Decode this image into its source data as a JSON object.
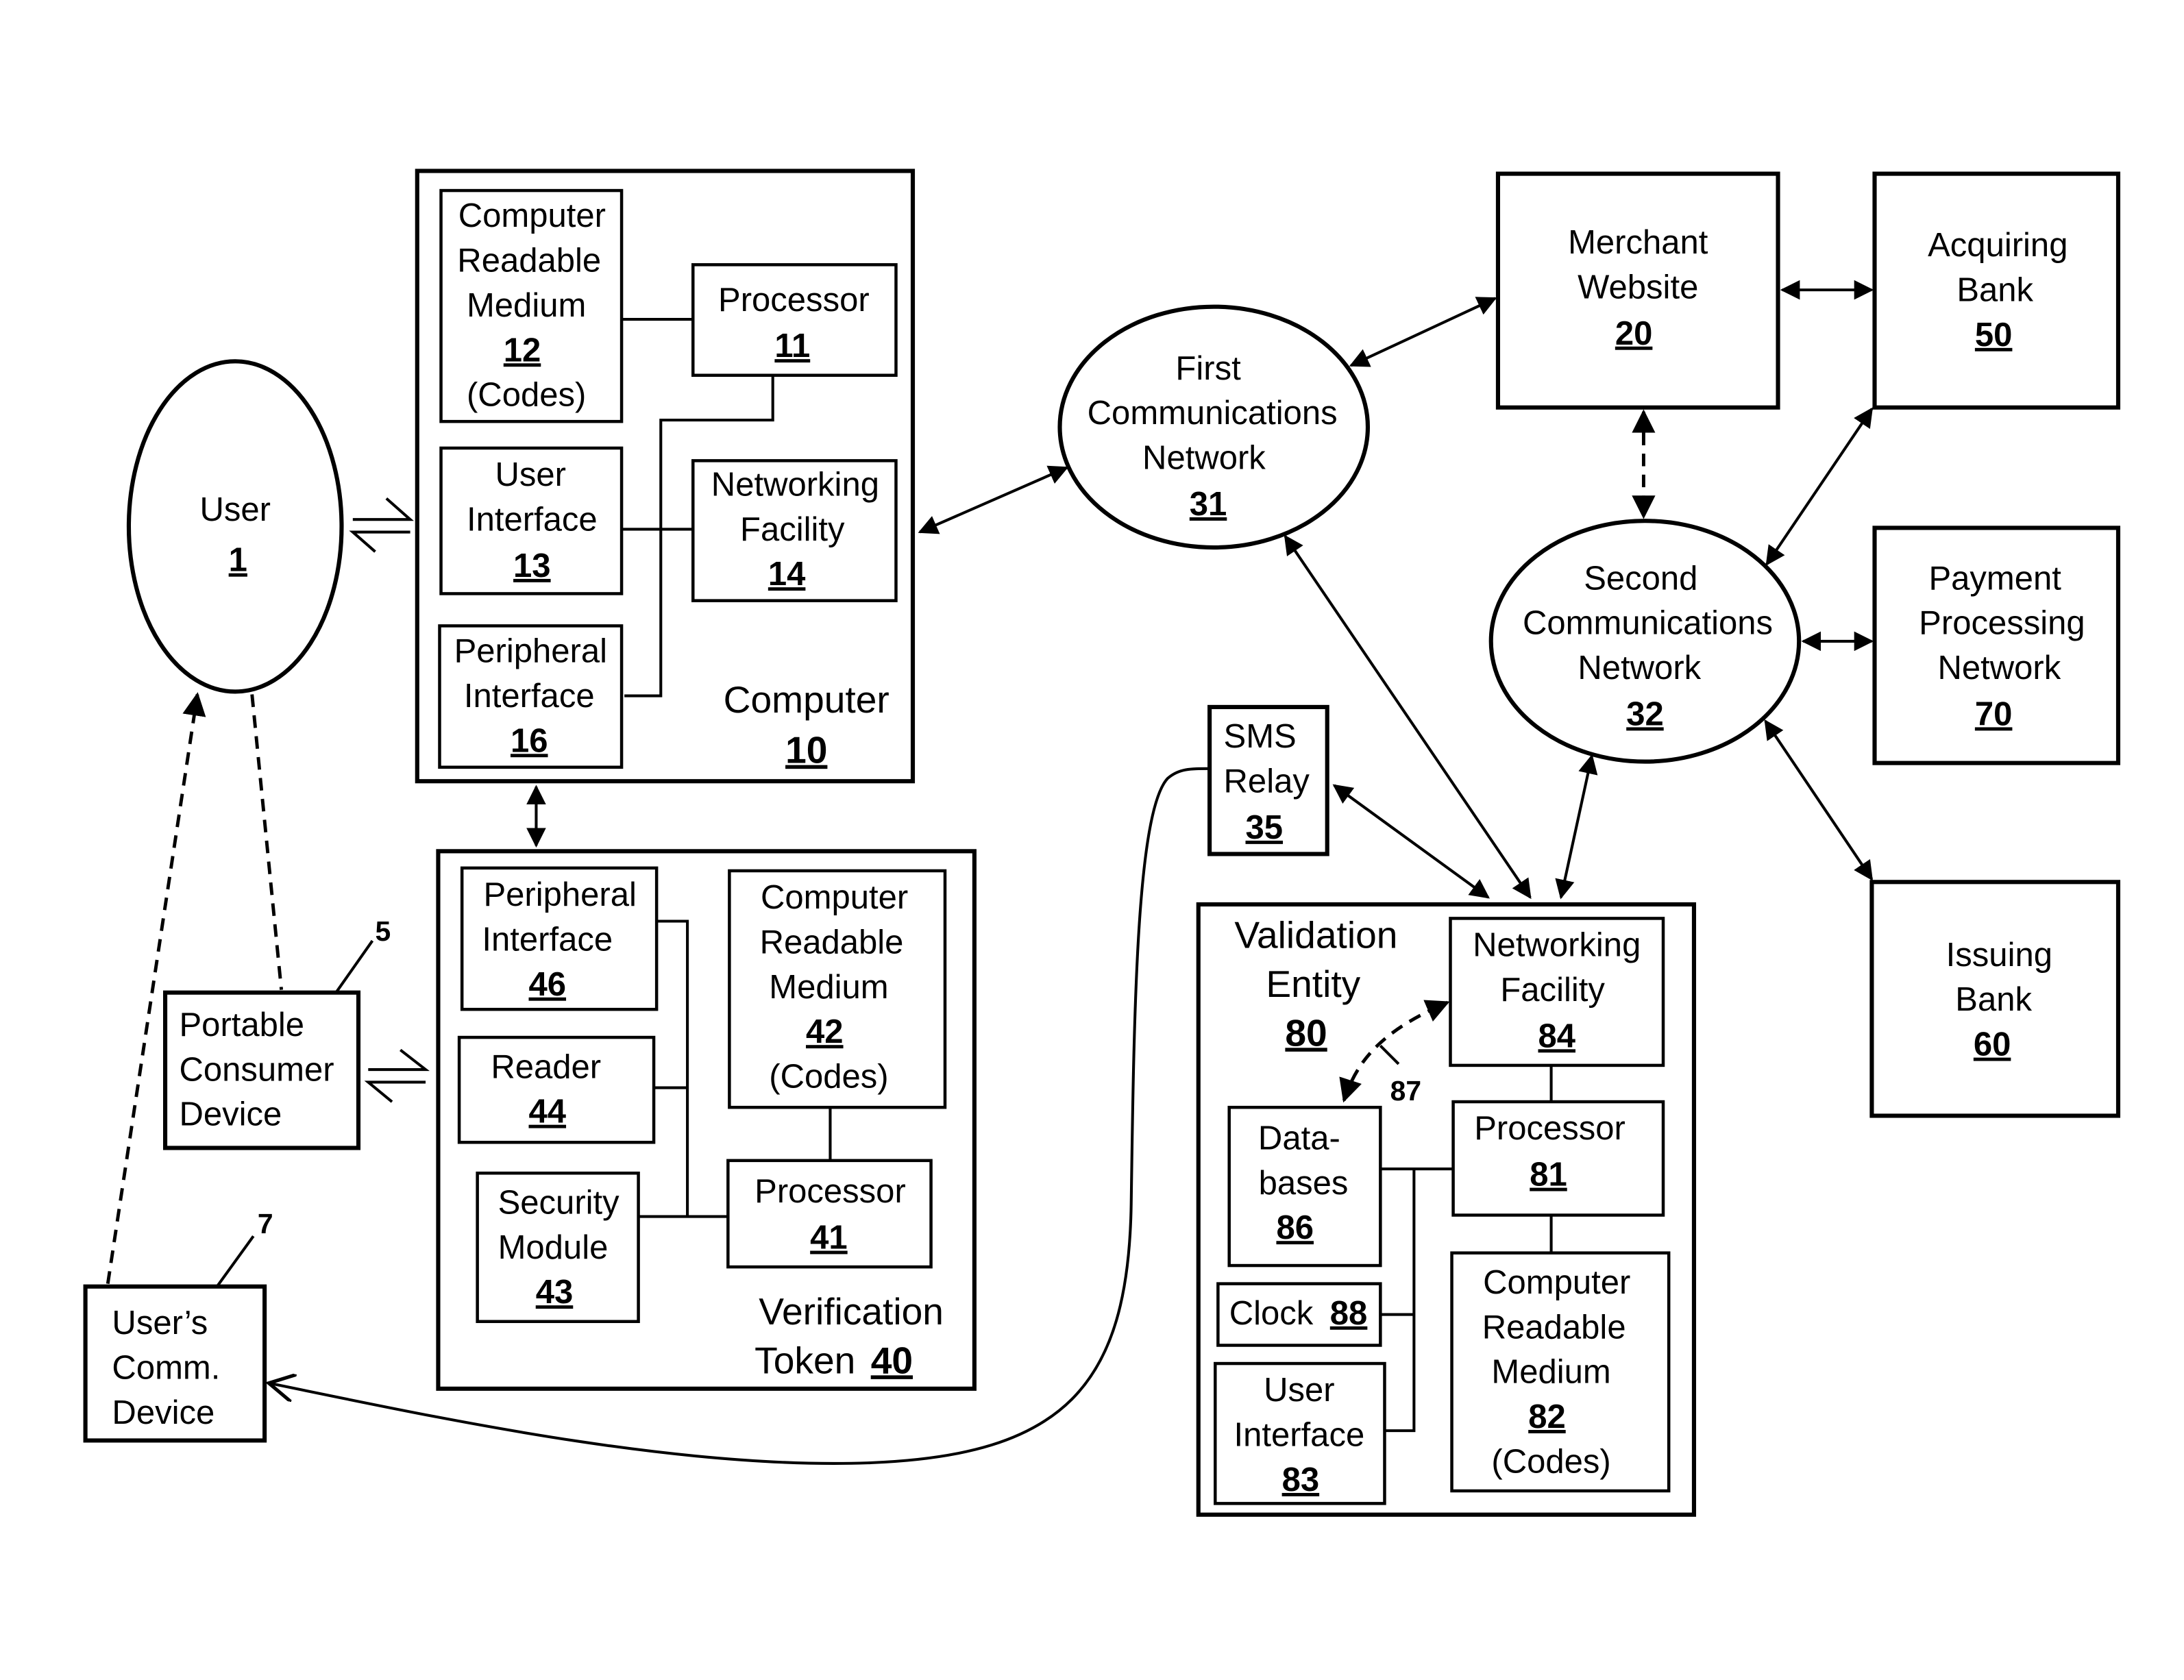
{
  "diagram": {
    "user": {
      "label": "User",
      "ref": "1"
    },
    "portable_device": {
      "lines": [
        "Portable",
        "Consumer",
        "Device"
      ],
      "callout": "5"
    },
    "comm_device": {
      "lines": [
        "User’s",
        "Comm.",
        "Device"
      ],
      "callout": "7"
    },
    "computer": {
      "label": "Computer",
      "ref": "10",
      "crm": {
        "lines": [
          "Computer",
          "Readable",
          "Medium"
        ],
        "ref": "12",
        "note": "(Codes)"
      },
      "processor": {
        "label": "Processor",
        "ref": "11"
      },
      "user_interface": {
        "lines": [
          "User",
          "Interface"
        ],
        "ref": "13"
      },
      "networking": {
        "lines": [
          "Networking",
          "Facility"
        ],
        "ref": "14"
      },
      "peripheral": {
        "lines": [
          "Peripheral",
          "Interface"
        ],
        "ref": "16"
      }
    },
    "token": {
      "lines": [
        "Verification",
        "Token"
      ],
      "ref": "40",
      "peripheral": {
        "lines": [
          "Peripheral",
          "Interface"
        ],
        "ref": "46"
      },
      "reader": {
        "label": "Reader",
        "ref": "44"
      },
      "security": {
        "lines": [
          "Security",
          "Module"
        ],
        "ref": "43"
      },
      "crm": {
        "lines": [
          "Computer",
          "Readable",
          "Medium"
        ],
        "ref": "42",
        "note": "(Codes)"
      },
      "processor": {
        "label": "Processor",
        "ref": "41"
      }
    },
    "first_network": {
      "lines": [
        "First",
        "Communications",
        "Network"
      ],
      "ref": "31"
    },
    "second_network": {
      "lines": [
        "Second",
        "Communications",
        "Network"
      ],
      "ref": "32"
    },
    "merchant": {
      "lines": [
        "Merchant",
        "Website"
      ],
      "ref": "20"
    },
    "acquiring": {
      "lines": [
        "Acquiring",
        "Bank"
      ],
      "ref": "50"
    },
    "payment": {
      "lines": [
        "Payment",
        "Processing",
        "Network"
      ],
      "ref": "70"
    },
    "issuing": {
      "lines": [
        "Issuing",
        "Bank"
      ],
      "ref": "60"
    },
    "sms": {
      "lines": [
        "SMS",
        "Relay"
      ],
      "ref": "35"
    },
    "validation": {
      "lines": [
        "Validation",
        "Entity"
      ],
      "ref": "80",
      "networking": {
        "lines": [
          "Networking",
          "Facility"
        ],
        "ref": "84"
      },
      "processor": {
        "label": "Processor",
        "ref": "81"
      },
      "databases": {
        "lines": [
          "Data-",
          "bases"
        ],
        "ref": "86"
      },
      "clock": {
        "label": "Clock",
        "ref": "88"
      },
      "user_interface": {
        "lines": [
          "User",
          "Interface"
        ],
        "ref": "83"
      },
      "crm": {
        "lines": [
          "Computer",
          "Readable",
          "Medium"
        ],
        "ref": "82",
        "note": "(Codes)"
      },
      "link_callout": "87"
    }
  }
}
